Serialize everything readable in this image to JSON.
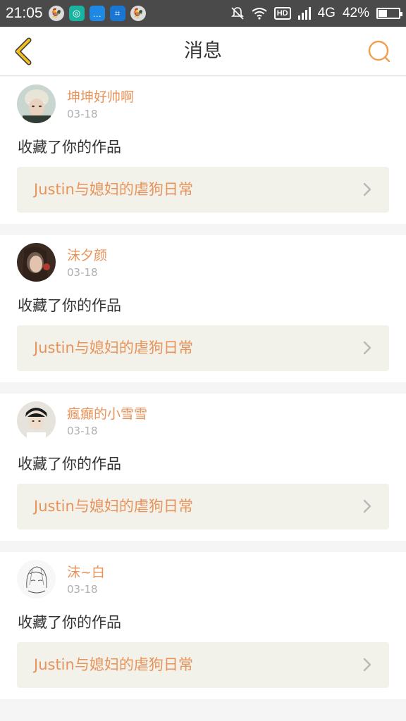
{
  "status_bar": {
    "time": "21:05",
    "network": "4G",
    "battery_percent": "42%",
    "battery_level": 0.42,
    "hd_label": "HD",
    "icons": [
      "rooster-icon",
      "chat-app-icon",
      "message-icon",
      "scan-icon",
      "rooster-icon",
      "mute-icon",
      "wifi-icon",
      "hd-icon",
      "signal-icon",
      "battery-icon"
    ]
  },
  "header": {
    "title": "消息",
    "back_icon": "chevron-left-icon",
    "search_icon": "search-icon",
    "accent_color": "#f0c020"
  },
  "messages": [
    {
      "username": "坤坤好帅啊",
      "date": "03-18",
      "action": "收藏了你的作品",
      "work_title": "Justin与媳妇的虐狗日常"
    },
    {
      "username": "沫夕颜",
      "date": "03-18",
      "action": "收藏了你的作品",
      "work_title": "Justin与媳妇的虐狗日常"
    },
    {
      "username": "瘋癲的小雪雪",
      "date": "03-18",
      "action": "收藏了你的作品",
      "work_title": "Justin与媳妇的虐狗日常"
    },
    {
      "username": "沫~白",
      "date": "03-18",
      "action": "收藏了你的作品",
      "work_title": "Justin与媳妇的虐狗日常"
    }
  ],
  "colors": {
    "username": "#e8935a",
    "link_bg": "#f2f1ea",
    "back_arrow": "#f0c020",
    "search": "#f0a050"
  }
}
